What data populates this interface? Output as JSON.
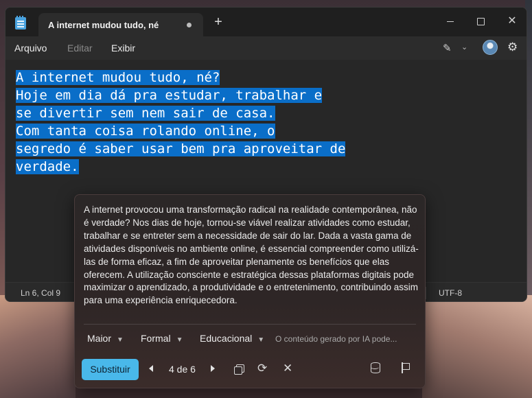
{
  "window": {
    "tab_title": "A internet mudou tudo, né",
    "new_tab_symbol": "+",
    "close_symbol": "✕"
  },
  "menu": {
    "items": [
      "Arquivo",
      "Editar",
      "Exibir"
    ]
  },
  "editor": {
    "lines": [
      "A internet mudou tudo, né?",
      "Hoje em dia dá pra estudar, trabalhar e",
      "se divertir sem nem sair de casa.",
      "Com tanta coisa rolando online, o",
      "segredo é saber usar bem pra aproveitar de",
      "verdade."
    ],
    "selection_color": "#0a6ec8"
  },
  "status": {
    "position": "Ln 6, Col 9",
    "encoding": "UTF-8"
  },
  "rewrite": {
    "text": "A internet provocou uma transformação radical na realidade contemporânea, não é verdade? Nos dias de hoje, tornou-se viável realizar atividades como estudar, trabalhar e se entreter sem a necessidade de sair do lar. Dada a vasta gama de atividades disponíveis no ambiente online, é essencial compreender como utilizá-las de forma eficaz, a fim de aproveitar plenamente os benefícios que elas oferecem. A utilização consciente e estratégica dessas plataformas digitais pode maximizar o aprendizado, a produtividade e o entretenimento, contribuindo assim para uma experiência enriquecedora.",
    "options": {
      "length": "Maior",
      "tone": "Formal",
      "format": "Educacional"
    },
    "ai_note": "O conteúdo gerado por IA pode...",
    "replace_label": "Substituir",
    "page_indicator": "4 de 6",
    "accent_color": "#49b8ea"
  },
  "icons": {
    "app": "notepad-icon",
    "copilot": "copilot-rewrite-icon",
    "settings": "gear-icon",
    "copy": "copy-icon",
    "retry": "retry-icon",
    "dismiss": "dismiss-icon",
    "feedback": "database-icon",
    "report": "flag-icon"
  }
}
